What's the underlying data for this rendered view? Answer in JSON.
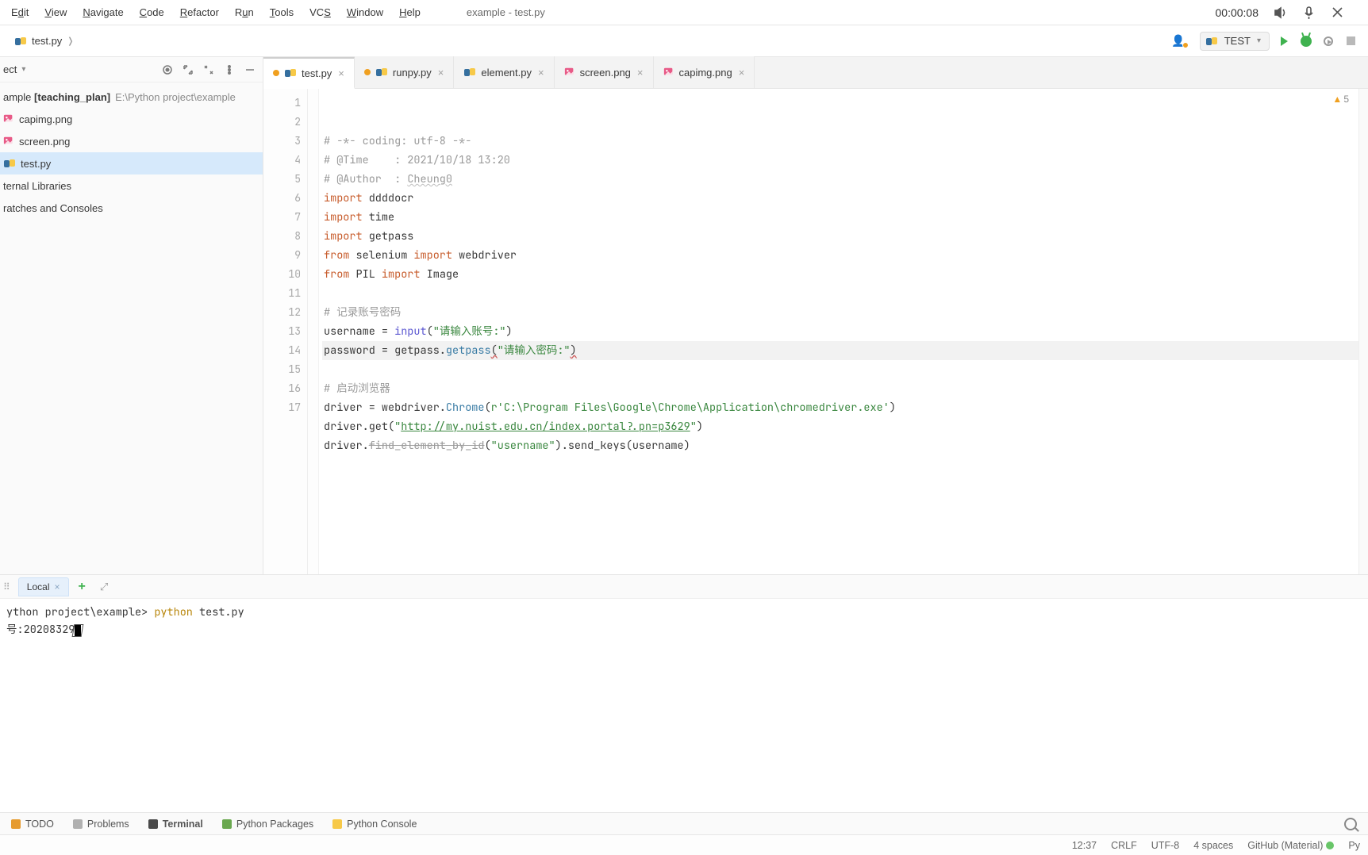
{
  "menubar": {
    "items": [
      "Edit",
      "View",
      "Navigate",
      "Code",
      "Refactor",
      "Run",
      "Tools",
      "VCS",
      "Window",
      "Help"
    ],
    "title": "example - test.py",
    "rec_time": "00:00:08"
  },
  "nav": {
    "opened_file": "test.py",
    "run_config": "TEST"
  },
  "project": {
    "selector": "ect",
    "root_label_bold": "[teaching_plan]",
    "root_prefix": "ample ",
    "root_path": "E:\\Python project\\example",
    "files": [
      "capimg.png",
      "screen.png",
      "test.py"
    ],
    "selected_index": 2,
    "extra": [
      "ternal Libraries",
      "ratches and Consoles"
    ]
  },
  "tabs": [
    {
      "label": "test.py",
      "active": true,
      "dirty": true,
      "icon": "py"
    },
    {
      "label": "runpy.py",
      "active": false,
      "dirty": true,
      "icon": "py"
    },
    {
      "label": "element.py",
      "active": false,
      "dirty": false,
      "icon": "py"
    },
    {
      "label": "screen.png",
      "active": false,
      "dirty": false,
      "icon": "img"
    },
    {
      "label": "capimg.png",
      "active": false,
      "dirty": false,
      "icon": "img"
    }
  ],
  "warn_count": "5",
  "code": {
    "lines": [
      {
        "n": 1,
        "html": "<span class='cmt'># -*- coding: utf-8 -*-</span>"
      },
      {
        "n": 2,
        "html": "<span class='cmt'># @Time    : 2021/10/18 13:20</span>"
      },
      {
        "n": 3,
        "html": "<span class='cmt'># @Author  : <span class='ul'>Cheung0</span></span>"
      },
      {
        "n": 4,
        "html": "<span class='kw'>import</span> ddddocr"
      },
      {
        "n": 5,
        "html": "<span class='kw'>import</span> time"
      },
      {
        "n": 6,
        "html": "<span class='kw'>import</span> getpass"
      },
      {
        "n": 7,
        "html": "<span class='kw'>from</span> selenium <span class='kw'>import</span> webdriver"
      },
      {
        "n": 8,
        "html": "<span class='kw'>from</span> PIL <span class='kw'>import</span> Image"
      },
      {
        "n": 9,
        "html": ""
      },
      {
        "n": 10,
        "html": "<span class='cmt'># 记录账号密码</span>"
      },
      {
        "n": 11,
        "html": "username = <span class='fn'>input</span>(<span class='str'>\"请输入账号:\"</span>)"
      },
      {
        "n": 12,
        "curr": true,
        "html": "password = getpass.<span class='fnw'>getpass</span><span class='err'>(</span><span class='str'>\"请输入密码:\"</span><span class='err'>)</span>"
      },
      {
        "n": 13,
        "html": ""
      },
      {
        "n": 14,
        "html": "<span class='cmt'># 启动浏览器</span>"
      },
      {
        "n": 15,
        "html": "driver = webdriver.<span class='fnw'>Chrome</span>(<span class='str'>r'C:\\Program Files\\Google\\Chrome\\Application\\chromedriver.exe'</span>)"
      },
      {
        "n": 16,
        "html": "driver.get(<span class='str'>\"<span class='url'>http://my.nuist.edu.cn/index.portal?.pn=p3629</span>\"</span>)"
      },
      {
        "n": 17,
        "html": "driver.<span class='strike'>find_element_by_id</span>(<span class='str'>\"username\"</span>).send_keys(username)"
      }
    ]
  },
  "terminal": {
    "tab": "Local",
    "prompt_prefix": "ython project\\example>",
    "command_py": "python",
    "command_arg": "test.py",
    "line2_prefix": "号:",
    "line2_value": "20208329"
  },
  "bottom_tabs": [
    "TODO",
    "Problems",
    "Terminal",
    "Python Packages",
    "Python Console"
  ],
  "status": {
    "pos": "12:37",
    "eol": "CRLF",
    "enc": "UTF-8",
    "indent": "4 spaces",
    "theme": "GitHub (Material)",
    "lang": "Py"
  }
}
